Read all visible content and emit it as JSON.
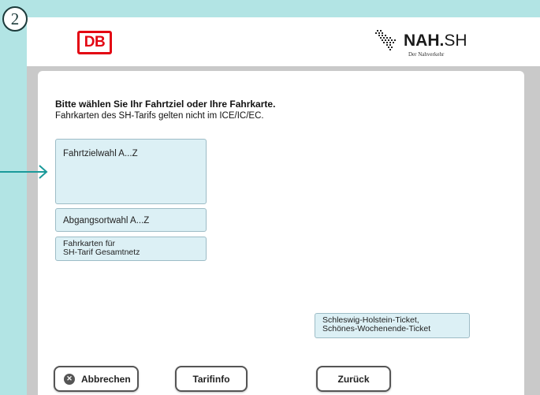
{
  "step": {
    "number": "2"
  },
  "header": {
    "db_logo_text": "DB",
    "nah_logo": {
      "bold": "NAH.",
      "regular": "SH",
      "sub": "Der Nahverkehr"
    }
  },
  "main": {
    "headline": "Bitte wählen Sie Ihr Fahrtziel oder Ihre Fahrkarte.",
    "subline": "Fahrkarten des SH-Tarifs gelten nicht im ICE/IC/EC.",
    "tiles": {
      "destination": "Fahrtzielwahl A...Z",
      "departure": "Abgangsortwahl A...Z",
      "sh_tarif_line1": "Fahrkarten für",
      "sh_tarif_line2": "SH-Tarif Gesamtnetz",
      "ticket_line1": "Schleswig-Holstein-Ticket,",
      "ticket_line2": "Schönes-Wochenende-Ticket"
    }
  },
  "buttons": {
    "cancel": "Abbrechen",
    "tarifinfo": "Tarifinfo",
    "back": "Zurück"
  },
  "icons": {
    "cancel": "close-circle-icon",
    "annotation": "arrow-right-icon"
  },
  "colors": {
    "background": "#b2e4e4",
    "db_red": "#e30613",
    "tile": "#dcf0f5",
    "arrow": "#1a9a9a"
  }
}
